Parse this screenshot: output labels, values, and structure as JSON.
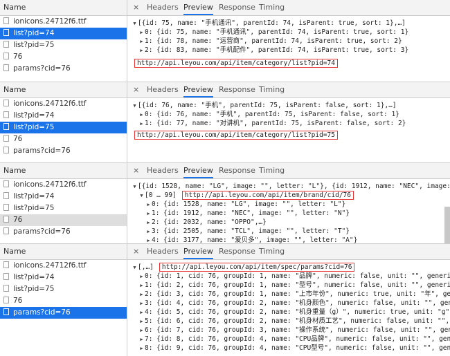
{
  "list_header": "Name",
  "tabs": {
    "close": "×",
    "headers": "Headers",
    "preview": "Preview",
    "response": "Response",
    "timing": "Timing"
  },
  "panels": [
    {
      "files": [
        "ionicons.24712f6.ttf",
        "list?pid=74",
        "list?pid=75",
        "76",
        "params?cid=76"
      ],
      "lines": [
        {
          "indent": 0,
          "tri": "▼",
          "text": "[{id: 75, name: \"手机通讯\", parentId: 74, isParent: true, sort: 1},…]"
        },
        {
          "indent": 1,
          "tri": "▶",
          "text": "0: {id: 75, name: \"手机通讯\", parentId: 74, isParent: true, sort: 1}"
        },
        {
          "indent": 1,
          "tri": "▶",
          "text": "1: {id: 78, name: \"运营商\", parentId: 74, isParent: true, sort: 2}"
        },
        {
          "indent": 1,
          "tri": "▶",
          "text": "2: {id: 83, name: \"手机配件\", parentId: 74, isParent: true, sort: 3}"
        }
      ],
      "url": "http://api.leyou.com/api/item/category/list?pid=74"
    },
    {
      "files": [
        "ionicons.24712f6.ttf",
        "list?pid=74",
        "list?pid=75",
        "76",
        "params?cid=76"
      ],
      "lines": [
        {
          "indent": 0,
          "tri": "▼",
          "text": "[{id: 76, name: \"手机\", parentId: 75, isParent: false, sort: 1},…]"
        },
        {
          "indent": 1,
          "tri": "▶",
          "text": "0: {id: 76, name: \"手机\", parentId: 75, isParent: false, sort: 1}"
        },
        {
          "indent": 1,
          "tri": "▶",
          "text": "1: {id: 77, name: \"对讲机\", parentId: 75, isParent: false, sort: 2}"
        }
      ],
      "url": "http://api.leyou.com/api/item/category/list?pid=75"
    },
    {
      "files": [
        "ionicons.24712f6.ttf",
        "list?pid=74",
        "list?pid=75",
        "76",
        "params?cid=76"
      ],
      "lines": [
        {
          "indent": 0,
          "tri": "▼",
          "text": "[{id: 1528, name: \"LG\", image: \"\", letter: \"L\"}, {id: 1912, name: \"NEC\", image: \""
        },
        {
          "indent": 1,
          "tri": "▼",
          "text": "[0 … 99]"
        },
        {
          "indent": 2,
          "tri": "▶",
          "text": "0: {id: 1528, name: \"LG\", image: \"\", letter: \"L\"}"
        },
        {
          "indent": 2,
          "tri": "▶",
          "text": "1: {id: 1912, name: \"NEC\", image: \"\", letter: \"N\"}"
        },
        {
          "indent": 2,
          "tri": "▶",
          "text": "2: {id: 2032, name: \"OPPO\",…}"
        },
        {
          "indent": 2,
          "tri": "▶",
          "text": "3: {id: 2505, name: \"TCL\", image: \"\", letter: \"T\"}"
        },
        {
          "indent": 2,
          "tri": "▶",
          "text": "4: {id: 3177, name: \"爱贝多\", image: \"\", letter: \"A\"}"
        }
      ],
      "url": "http://api.leyou.com/api/item/brand/cid/76"
    },
    {
      "files": [
        "ionicons.24712f6.ttf",
        "list?pid=74",
        "list?pid=75",
        "76",
        "params?cid=76"
      ],
      "lines": [
        {
          "indent": 0,
          "tri": "▼",
          "text": "[,…]"
        },
        {
          "indent": 1,
          "tri": "▶",
          "text": "0: {id: 1, cid: 76, groupId: 1, name: \"品牌\", numeric: false, unit: \"\", generic:"
        },
        {
          "indent": 1,
          "tri": "▶",
          "text": "1: {id: 2, cid: 76, groupId: 1, name: \"型号\", numeric: false, unit: \"\", generic:"
        },
        {
          "indent": 1,
          "tri": "▶",
          "text": "2: {id: 3, cid: 76, groupId: 1, name: \"上市年份\", numeric: true, unit: \"年\", gene"
        },
        {
          "indent": 1,
          "tri": "▶",
          "text": "3: {id: 4, cid: 76, groupId: 2, name: \"机身颜色\", numeric: false, unit: \"\", gene"
        },
        {
          "indent": 1,
          "tri": "▶",
          "text": "4: {id: 5, cid: 76, groupId: 2, name: \"机身重量（g）\", numeric: true, unit: \"g\","
        },
        {
          "indent": 1,
          "tri": "▶",
          "text": "5: {id: 6, cid: 76, groupId: 2, name: \"机身材质工艺\", numeric: false, unit: \"\","
        },
        {
          "indent": 1,
          "tri": "▶",
          "text": "6: {id: 7, cid: 76, groupId: 3, name: \"操作系统\", numeric: false, unit: \"\", gene"
        },
        {
          "indent": 1,
          "tri": "▶",
          "text": "7: {id: 8, cid: 76, groupId: 4, name: \"CPU品牌\", numeric: false, unit: \"\", gener"
        },
        {
          "indent": 1,
          "tri": "▶",
          "text": "8: {id: 9, cid: 76, groupId: 4, name: \"CPU型号\", numeric: false, unit: \"\", gener"
        }
      ],
      "url": "http://api.leyou.com/api/item/spec/params?cid=76"
    }
  ]
}
